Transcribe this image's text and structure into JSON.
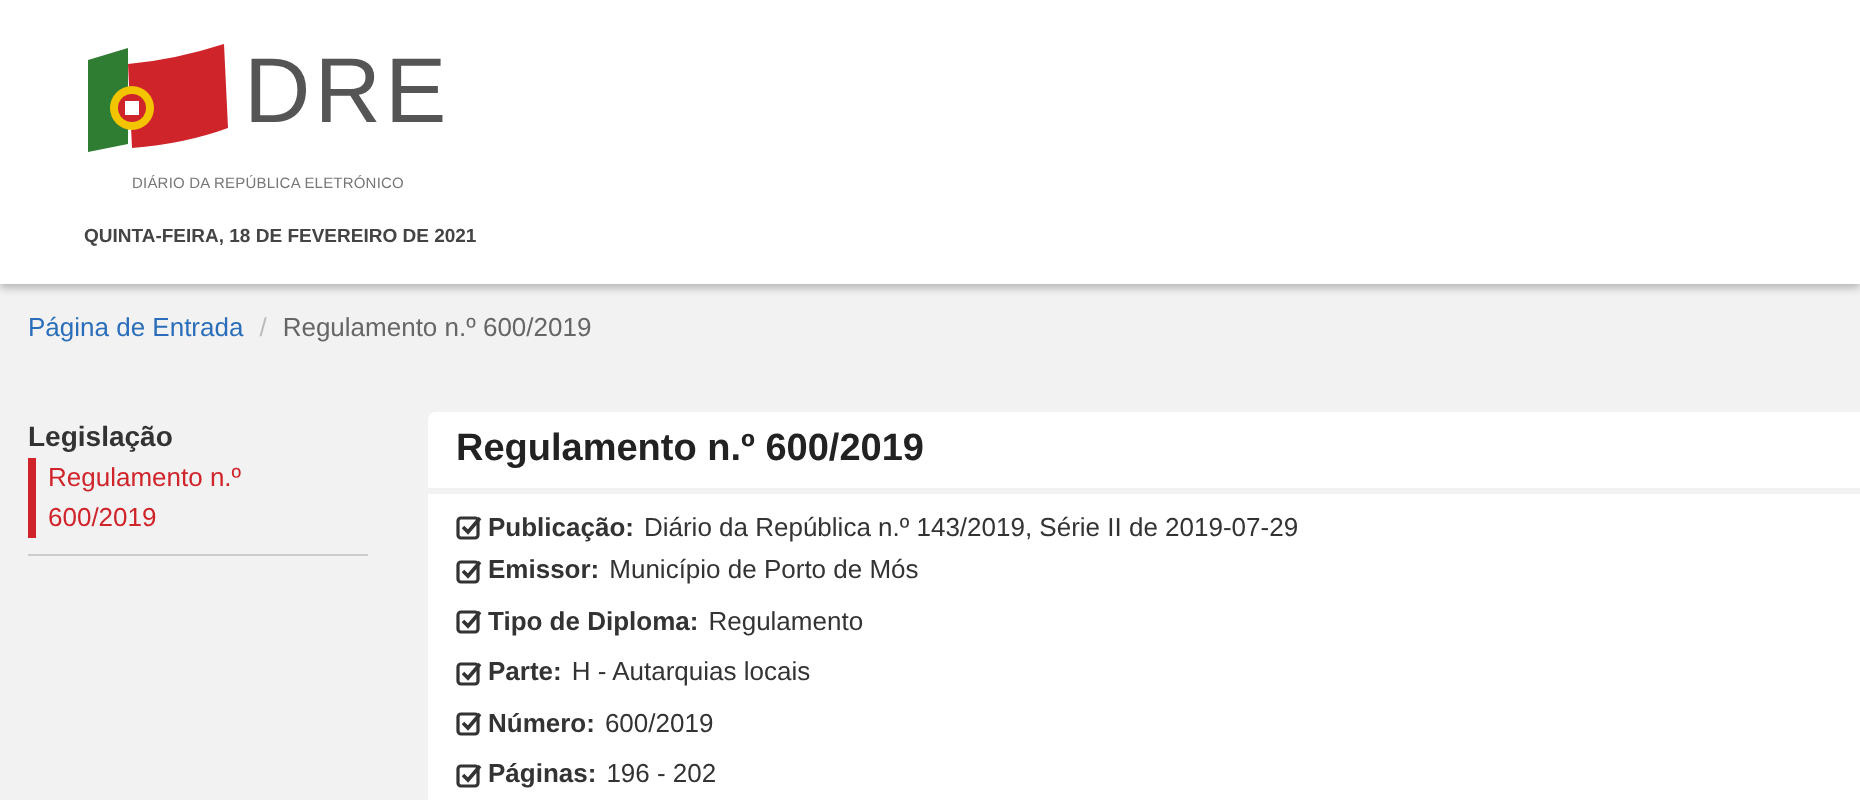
{
  "header": {
    "logo_text": "DRE",
    "logo_subtitle": "DIÁRIO DA REPÚBLICA ELETRÓNICO",
    "date": "QUINTA-FEIRA, 18 DE FEVEREIRO DE 2021"
  },
  "breadcrumb_separator": "/",
  "breadcrumb": [
    {
      "label": "Página de Entrada",
      "link": true
    },
    {
      "label": "Regulamento n.º 600/2019",
      "link": false
    }
  ],
  "sidebar": {
    "title": "Legislação",
    "items": [
      {
        "label": "Regulamento n.º 600/2019",
        "selected": true
      }
    ]
  },
  "document": {
    "title": "Regulamento n.º 600/2019",
    "fields": [
      {
        "label": "Publicação:",
        "value": "Diário da República n.º 143/2019, Série II de 2019-07-29"
      },
      {
        "label": "Emissor:",
        "value": "Município de Porto de Mós"
      },
      {
        "label": "Tipo de Diploma:",
        "value": "Regulamento"
      },
      {
        "label": "Parte:",
        "value": "H - Autarquias locais"
      },
      {
        "label": "Número:",
        "value": "600/2019"
      },
      {
        "label": "Páginas:",
        "value": "196 - 202"
      }
    ]
  }
}
